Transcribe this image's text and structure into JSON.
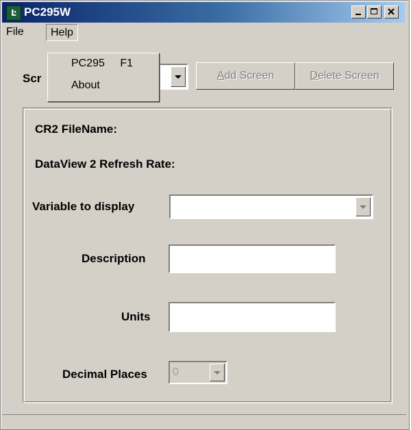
{
  "window": {
    "title": "PC295W",
    "icon": "app-icon",
    "min_icon": "minimize-icon",
    "max_icon": "maximize-icon",
    "close_icon": "close-icon"
  },
  "menubar": {
    "file_label": "File",
    "help_label": "Help"
  },
  "help_menu": {
    "items": [
      {
        "label": "PC295",
        "shortcut": "F1"
      },
      {
        "label": "About"
      }
    ]
  },
  "toolbar": {
    "screens_label": "Scr",
    "screen_selected": "",
    "add_label": "Add Screen",
    "add_mnemonic": "A",
    "delete_label": "Delete Screen",
    "delete_mnemonic": "D"
  },
  "group": {
    "filename_label": "CR2 FileName:",
    "refresh_label": "DataView 2 Refresh Rate:",
    "variable_label": "Variable to display",
    "variable_value": "",
    "description_label": "Description",
    "description_value": "",
    "units_label": "Units",
    "units_value": "",
    "decimal_label": "Decimal Places",
    "decimal_value": "0"
  }
}
